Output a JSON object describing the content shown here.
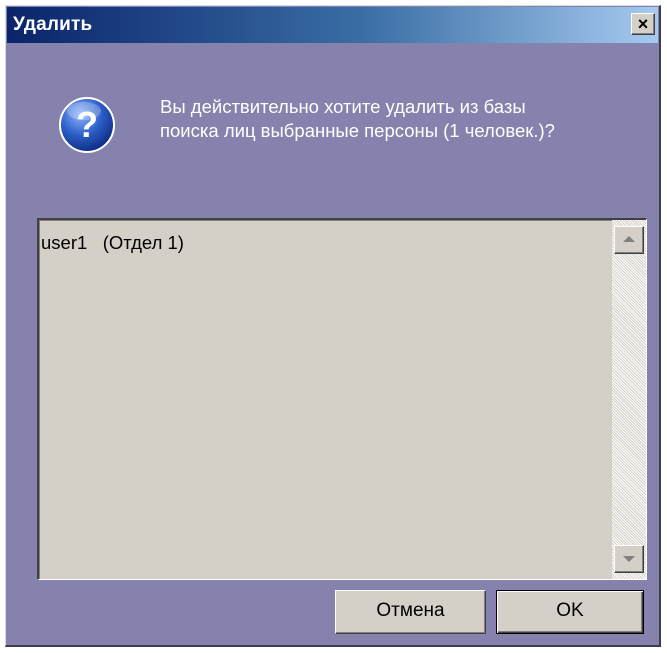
{
  "window": {
    "title": "Удалить",
    "close_glyph": "×",
    "close_icon": "close-icon"
  },
  "dialog": {
    "icon": "question-icon",
    "icon_glyph": "?",
    "message_line1": "Вы действительно хотите удалить из базы",
    "message_line2": "поиска лиц выбранные персоны (1 человек.)?"
  },
  "list": {
    "items": [
      "user1   (Отдел 1)"
    ]
  },
  "buttons": {
    "cancel_label": "Отмена",
    "ok_label": "OK"
  },
  "colors": {
    "dialog_background": "#8583ad",
    "title_gradient_start": "#0a246a",
    "title_gradient_end": "#a6caf0",
    "icon_blue": "#1f4fb0"
  }
}
